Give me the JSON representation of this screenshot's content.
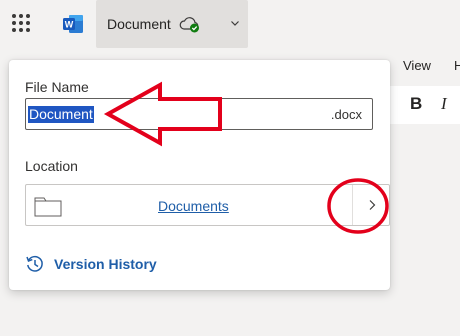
{
  "header": {
    "doc_title": "Document",
    "app_icon": "word-icon",
    "sync_icon": "cloud-check-icon",
    "menu_icon": "waffle-icon"
  },
  "ribbon": {
    "view_tab": "View",
    "more_tab": "H",
    "bold": "B",
    "italic": "I"
  },
  "panel": {
    "file_name_label": "File Name",
    "file_name_value": "Document",
    "file_extension": ".docx",
    "location_label": "Location",
    "location_link": "Documents",
    "version_history": "Version History"
  },
  "colors": {
    "accent": "#1f5ea8",
    "selection": "#1f56c2",
    "annotation": "#e3001b"
  }
}
